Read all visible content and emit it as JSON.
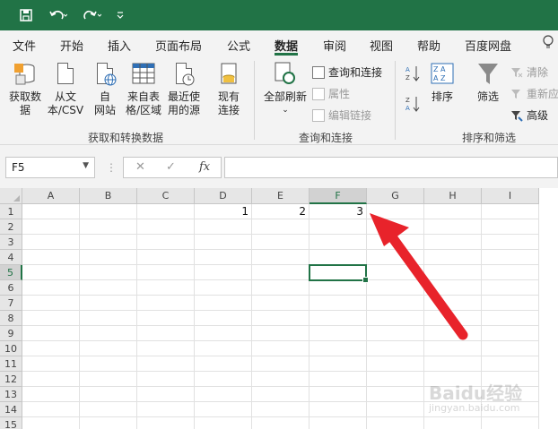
{
  "quick_access": {
    "save_icon": "save-icon",
    "undo_icon": "undo-icon",
    "redo_icon": "redo-icon",
    "more_icon": "customize-icon"
  },
  "tabs": [
    "文件",
    "开始",
    "插入",
    "页面布局",
    "公式",
    "数据",
    "审阅",
    "视图",
    "帮助",
    "百度网盘"
  ],
  "active_tab": "数据",
  "ribbon": {
    "get_transform": {
      "get_data": "获取数\n据",
      "from_csv": "从文\n本/CSV",
      "from_web": "自\n网站",
      "from_table": "来自表\n格/区域",
      "recent_sources": "最近使\n用的源",
      "existing_connections": "现有\n连接",
      "label": "获取和转换数据"
    },
    "queries": {
      "refresh_all": "全部刷新",
      "queries_connections": "查询和连接",
      "properties": "属性",
      "edit_links": "编辑链接",
      "label": "查询和连接"
    },
    "sort_filter": {
      "sort": "排序",
      "filter": "筛选",
      "clear": "清除",
      "reapply": "重新应",
      "advanced": "高级",
      "label": "排序和筛选"
    }
  },
  "formula_bar": {
    "name_box": "F5",
    "fx": "fx",
    "value": ""
  },
  "sheet": {
    "columns": [
      "A",
      "B",
      "C",
      "D",
      "E",
      "F",
      "G",
      "H",
      "I"
    ],
    "rows": [
      "1",
      "2",
      "3",
      "4",
      "5",
      "6",
      "7",
      "8",
      "9",
      "10",
      "11",
      "12",
      "13",
      "14",
      "15"
    ],
    "cells": {
      "D1": "1",
      "E1": "2",
      "F1": "3"
    },
    "active_cell": "F5",
    "selected_column": "F",
    "selected_row": "5"
  },
  "colors": {
    "accent": "#217346",
    "arrow": "#e8232b"
  },
  "watermark": {
    "brand": "Baidu经验",
    "url": "jingyan.baidu.com"
  }
}
